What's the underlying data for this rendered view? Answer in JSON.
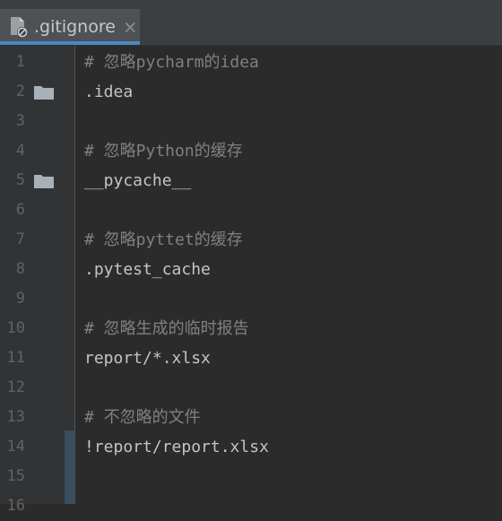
{
  "tab": {
    "filename": ".gitignore",
    "close_glyph": "×",
    "file_icon": "gitignore-file-icon",
    "close_icon": "close-icon"
  },
  "colors": {
    "background": "#2b2b2b",
    "gutter": "#313335",
    "tab_active": "#4e5254",
    "accent": "#4a88c7",
    "comment": "#808080",
    "text": "#c4c4c4",
    "line_number": "#606366"
  },
  "lines": [
    {
      "num": "1",
      "text": "# 忽略pycharm的idea",
      "kind": "comment",
      "folder": false
    },
    {
      "num": "2",
      "text": ".idea",
      "kind": "path",
      "folder": true
    },
    {
      "num": "3",
      "text": "",
      "kind": "blank",
      "folder": false
    },
    {
      "num": "4",
      "text": "# 忽略Python的缓存",
      "kind": "comment",
      "folder": false
    },
    {
      "num": "5",
      "text": "__pycache__",
      "kind": "path",
      "folder": true
    },
    {
      "num": "6",
      "text": "",
      "kind": "blank",
      "folder": false
    },
    {
      "num": "7",
      "text": "# 忽略pyttet的缓存",
      "kind": "comment",
      "folder": false
    },
    {
      "num": "8",
      "text": ".pytest_cache",
      "kind": "path",
      "folder": false
    },
    {
      "num": "9",
      "text": "",
      "kind": "blank",
      "folder": false
    },
    {
      "num": "10",
      "text": "# 忽略生成的临时报告",
      "kind": "comment",
      "folder": false
    },
    {
      "num": "11",
      "text": "report/*.xlsx",
      "kind": "path",
      "folder": false
    },
    {
      "num": "12",
      "text": "",
      "kind": "blank",
      "folder": false
    },
    {
      "num": "13",
      "text": "# 不忽略的文件",
      "kind": "comment",
      "folder": false
    },
    {
      "num": "14",
      "text": "!report/report.xlsx",
      "kind": "path",
      "folder": false
    },
    {
      "num": "15",
      "text": "",
      "kind": "blank",
      "folder": false
    },
    {
      "num": "16",
      "text": "",
      "kind": "blank",
      "folder": false
    }
  ]
}
